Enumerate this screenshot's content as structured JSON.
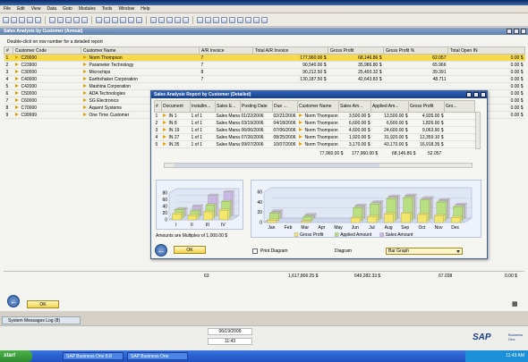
{
  "menu": [
    "File",
    "Edit",
    "View",
    "Data",
    "Goto",
    "Modules",
    "Tools",
    "Window",
    "Help"
  ],
  "main_window": {
    "title": "Sales Analysis by Customer (Annual)",
    "hint": "Double-click on row number for a detailed report",
    "columns": [
      "#",
      "Customer Code",
      "Customer Name",
      "A/R Invoice",
      "Total A/R Invoice",
      "Gross Profit",
      "Gross Profit %",
      "Total Open IN"
    ],
    "rows": [
      [
        "1",
        "C20000",
        "Norm Thompson",
        "7",
        "177,960.00 $",
        "68,146.86 $",
        "62.057",
        "0.00 $"
      ],
      [
        "2",
        "C23900",
        "Parameter Technology",
        "7",
        "90,540.00 $",
        "35,986.80 $",
        "65.966",
        "0.00 $"
      ],
      [
        "3",
        "C30000",
        "Microchips",
        "8",
        "90,212.50 $",
        "25,493.32 $",
        "39.391",
        "0.00 $"
      ],
      [
        "4",
        "C40000",
        "Earthshaker Corporation",
        "7",
        "130,187.50 $",
        "42,643.83 $",
        "48.711",
        "0.00 $"
      ],
      [
        "5",
        "C42000",
        "Mashina Corporation",
        "",
        "",
        "",
        "",
        "0.00 $"
      ],
      [
        "6",
        "C50000",
        "ADA Technologies",
        "",
        "",
        "",
        "",
        "0.00 $"
      ],
      [
        "7",
        "C60000",
        "SG Electronics",
        "",
        "",
        "",
        "",
        "0.00 $"
      ],
      [
        "8",
        "C70000",
        "Aquent Systems",
        "",
        "",
        "",
        "",
        "0.00 $"
      ],
      [
        "9",
        "C99999",
        "One Time Customer",
        "",
        "",
        "",
        "",
        "0.00 $"
      ]
    ],
    "totals": {
      "invoices": "63",
      "total_ar": "1,617,806.25 $",
      "gross_profit": "649,282.33 $",
      "gp_pct": "67.038",
      "open": "0.00 $"
    },
    "ok_label": "OK"
  },
  "dialog": {
    "title": "Sales Analysis Report by Customer (Detailed)",
    "columns": [
      "#",
      "Document",
      "Installm...",
      "Sales E...",
      "Posting Date",
      "Due ...",
      "Customer Name",
      "Sales Am...",
      "Applied Am...",
      "Gross Profit",
      "Gro..."
    ],
    "rows": [
      [
        "1",
        "IN 1",
        "1 of 1",
        "Sales Mana",
        "01/22/2006",
        "02/21/2006",
        "Norm Thompson",
        "3,500.00 $",
        "13,500.00 $",
        "4,935.00 $",
        ""
      ],
      [
        "2",
        "IN 8",
        "1 of 1",
        "Sales Mana",
        "03/19/2006",
        "04/18/2006",
        "Norm Thompson",
        "6,600.00 $",
        "6,600.00 $",
        "1,826.00 $",
        ""
      ],
      [
        "3",
        "IN 19",
        "1 of 1",
        "Sales Mana",
        "06/06/2006",
        "07/06/2006",
        "Norm Thompson",
        "4,600.00 $",
        "24,600.00 $",
        "9,063.90 $",
        ""
      ],
      [
        "4",
        "IN 27",
        "1 of 1",
        "Sales Mana",
        "07/26/2006",
        "08/25/2006",
        "Norm Thompson",
        "1,920.00 $",
        "31,920.00 $",
        "12,359.10 $",
        ""
      ],
      [
        "5",
        "IN 35",
        "1 of 1",
        "Sales Mana",
        "09/07/2006",
        "10/07/2006",
        "Norm Thompson",
        "3,170.00 $",
        "43,170.00 $",
        "16,918.35 $",
        ""
      ]
    ],
    "totals": {
      "sales": "77,960.00 $",
      "applied": "177,960.00 $",
      "profit": "68,146.86 $",
      "gp": "52.057"
    },
    "amounts_note": "Amounts are Multiples of 1,000.00 $",
    "ok_label": "OK",
    "print_label": "Print Diagram",
    "diagram_label": "Diagram",
    "diagram_value": "Bar Graph"
  },
  "chart_data": [
    {
      "type": "bar",
      "categories": [
        "I",
        "II",
        "III",
        "IV"
      ],
      "yticks": [
        "80",
        "60",
        "40",
        "20",
        "0"
      ],
      "ylim": [
        0,
        80
      ],
      "series": [
        {
          "values": [
            18,
            13,
            24,
            29
          ]
        },
        {
          "values": [
            24,
            20,
            38,
            48
          ]
        },
        {
          "values": [
            20,
            28,
            60,
            70
          ]
        }
      ]
    },
    {
      "type": "bar",
      "categories": [
        "Jan",
        "Feb",
        "Mar",
        "Apr",
        "May",
        "Jun",
        "Jul",
        "Aug",
        "Sep",
        "Oct",
        "Nov",
        "Dec"
      ],
      "yticks": [
        "60",
        "40",
        "20",
        "0"
      ],
      "ylim": [
        0,
        60
      ],
      "legend": [
        "Gross Profit",
        "Applied Amount",
        "Sales Amount"
      ],
      "series": [
        {
          "name": "Gross Profit",
          "values": [
            5,
            0,
            2,
            0,
            0,
            9,
            12,
            17,
            18,
            16,
            14,
            10
          ]
        },
        {
          "name": "Applied Amount",
          "values": [
            14,
            0,
            7,
            0,
            0,
            25,
            32,
            43,
            45,
            40,
            36,
            27
          ]
        },
        {
          "name": "Sales Amount",
          "values": [
            14,
            0,
            7,
            0,
            0,
            25,
            32,
            43,
            45,
            40,
            36,
            27
          ]
        }
      ]
    }
  ],
  "colors": {
    "gross_profit": "#f3e66a",
    "applied": "#b8e080",
    "sales": "#c9b7e6",
    "selected_row": "#f7d94c"
  },
  "status": {
    "syslog": "System Messages Log (8)",
    "date": "06/19/2009",
    "time": "11:43",
    "logo": "SAP",
    "logo_sub1": "Business",
    "logo_sub2": "One"
  },
  "taskbar": {
    "start": "start",
    "tasks": [
      "SAP Business One 8.8",
      "SAP Business One"
    ],
    "clock": "11:43 AM"
  }
}
